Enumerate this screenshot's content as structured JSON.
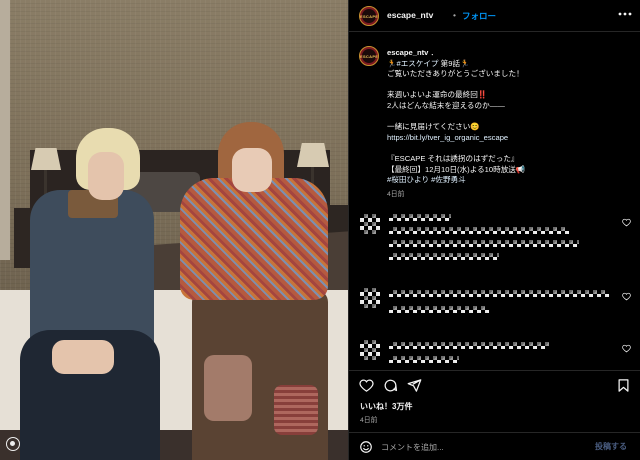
{
  "header": {
    "username": "escape_ntv",
    "separator": "•",
    "follow_label": "フォロー",
    "more_icon": "more-horizontal-icon",
    "avatar_text": "ESCAPE"
  },
  "caption": {
    "username": "escape_ntv",
    "separator": "．",
    "line1_pre": "🏃",
    "line1_hashtag": "#エスケイプ",
    "line1_post": " 第9話🏃",
    "line2": "ご覧いただきありがとうございました！",
    "line3": "来週いよいよ運命の最終回‼️",
    "line4": "2人はどんな結末を迎えるのか——",
    "line5": "一緒に見届けてください😊",
    "line6": "https://bit.ly/tver_ig_organic_escape",
    "line7": "『ESCAPE それは誘拐のはずだった』",
    "line8": "【最終回】12月10日(水)よる10時放送📢",
    "line9_hashtag1": "#桜田ひより",
    "line9_hashtag2": " #佐野勇斗",
    "time": "4日前"
  },
  "actions": {
    "like_icon": "heart-icon",
    "comment_icon": "comment-icon",
    "share_icon": "send-icon",
    "save_icon": "bookmark-icon"
  },
  "likes_label": "いいね！3万件",
  "post_time": "4日前",
  "comment_input": {
    "placeholder": "コメントを追加...",
    "emoji_icon": "emoji-icon",
    "post_label": "投稿する"
  },
  "colors": {
    "background": "#000000",
    "link": "#0095f6",
    "muted": "#a8a8a8",
    "text": "#f5f5f5",
    "post_disabled": "#4a5d80"
  }
}
